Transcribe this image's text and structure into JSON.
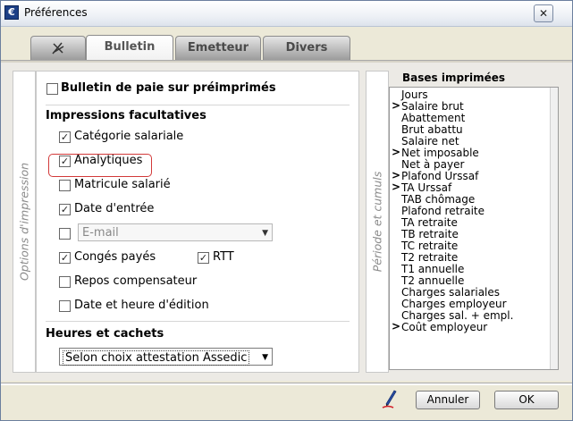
{
  "window": {
    "title": "Préférences",
    "close_glyph": "✕",
    "app_icon_letter": "€"
  },
  "tabs": [
    {
      "name": "icon-tab",
      "label": ""
    },
    {
      "name": "tab-bulletin",
      "label": "Bulletin",
      "active": true
    },
    {
      "name": "tab-emetteur",
      "label": "Emetteur"
    },
    {
      "name": "tab-divers",
      "label": "Divers"
    }
  ],
  "options_panel": {
    "side_label": "Options d'impression",
    "preprinted": {
      "label": "Bulletin de paie sur préimprimés",
      "checked": false
    },
    "section_impressions": "Impressions facultatives",
    "items": [
      {
        "label": "Catégorie salariale",
        "checked": true
      },
      {
        "label": "Analytiques",
        "checked": true
      },
      {
        "label": "Matricule salarié",
        "checked": false
      },
      {
        "label": "Date d'entrée",
        "checked": true
      }
    ],
    "email_checked": false,
    "email_placeholder": "E-mail",
    "conges": {
      "label": "Congés payés",
      "checked": true
    },
    "rtt": {
      "label": "RTT",
      "checked": true
    },
    "repos": {
      "label": "Repos compensateur",
      "checked": false
    },
    "date_edition": {
      "label": "Date et heure d'édition",
      "checked": false
    },
    "section_heures": "Heures et cachets",
    "heures_select": "Selon choix attestation Assedic"
  },
  "bases_panel": {
    "side_label": "Période et cumuls",
    "title": "Bases imprimées",
    "items": [
      {
        "label": "Jours",
        "marker": ""
      },
      {
        "label": "Salaire brut",
        "marker": ">"
      },
      {
        "label": "Abattement",
        "marker": ""
      },
      {
        "label": "Brut abattu",
        "marker": ""
      },
      {
        "label": "Salaire net",
        "marker": ""
      },
      {
        "label": "Net imposable",
        "marker": ">"
      },
      {
        "label": "Net à payer",
        "marker": ""
      },
      {
        "label": "Plafond Urssaf",
        "marker": ">"
      },
      {
        "label": "TA Urssaf",
        "marker": ">"
      },
      {
        "label": "TAB chômage",
        "marker": ""
      },
      {
        "label": "Plafond retraite",
        "marker": ""
      },
      {
        "label": "TA retraite",
        "marker": ""
      },
      {
        "label": "TB retraite",
        "marker": ""
      },
      {
        "label": "TC retraite",
        "marker": ""
      },
      {
        "label": "T2 retraite",
        "marker": ""
      },
      {
        "label": "T1 annuelle",
        "marker": ""
      },
      {
        "label": "T2 annuelle",
        "marker": ""
      },
      {
        "label": "Charges salariales",
        "marker": ""
      },
      {
        "label": "Charges employeur",
        "marker": ""
      },
      {
        "label": "Charges sal. + empl.",
        "marker": ""
      },
      {
        "label": "Coût employeur",
        "marker": ">"
      }
    ]
  },
  "buttons": {
    "cancel": "Annuler",
    "ok": "OK"
  },
  "colors": {
    "highlight": "#d23a3a",
    "window_bg": "#ece9d8",
    "title_icon": "#1c3f86"
  }
}
